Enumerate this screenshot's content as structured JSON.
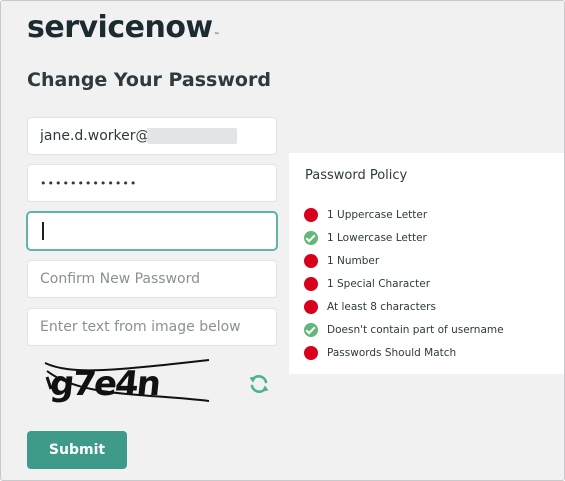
{
  "brand": {
    "logo_text": "servicenow",
    "logo_tm": "™"
  },
  "page": {
    "title": "Change Your Password"
  },
  "form": {
    "username_value": "jane.d.worker@",
    "old_password_value": "•••••••••••••",
    "new_password_value": "",
    "confirm_placeholder": "Confirm New Password",
    "captcha_placeholder": "Enter text from image below",
    "captcha_text": "g7e4n",
    "submit_label": "Submit"
  },
  "policy": {
    "title": "Password Policy",
    "rules": [
      {
        "label": "1 Uppercase Letter",
        "status": "fail"
      },
      {
        "label": "1 Lowercase Letter",
        "status": "pass"
      },
      {
        "label": "1 Number",
        "status": "fail"
      },
      {
        "label": "1 Special Character",
        "status": "fail"
      },
      {
        "label": "At least 8 characters",
        "status": "fail"
      },
      {
        "label": "Doesn't contain part of username",
        "status": "pass"
      },
      {
        "label": "Passwords Should Match",
        "status": "fail"
      }
    ]
  },
  "colors": {
    "accent": "#3e9b8a",
    "focus": "#63b3a8",
    "fail": "#d8001b",
    "pass": "#62b879",
    "brand_text": "#1b2b30",
    "refresh_icon": "#4cb38f"
  },
  "icons": {
    "refresh": "refresh-icon",
    "pass": "check-circle-icon",
    "fail": "error-dot-icon"
  }
}
